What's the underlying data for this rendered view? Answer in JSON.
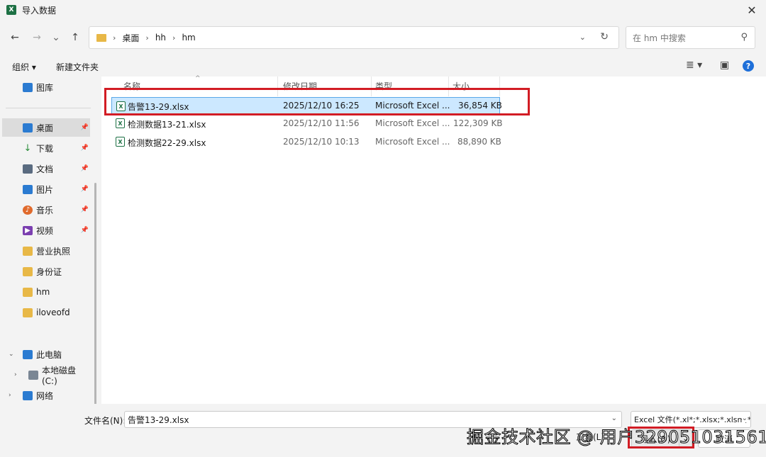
{
  "window": {
    "title": "导入数据",
    "app_icon": "X"
  },
  "nav": {
    "back": "←",
    "forward": "→",
    "recent": "⌄",
    "up": "↑",
    "breadcrumb": [
      "桌面",
      "hh",
      "hm"
    ],
    "separator": "›",
    "search_placeholder": "在 hm 中搜索"
  },
  "toolbar": {
    "organize": "组织 ▾",
    "new_folder": "新建文件夹"
  },
  "sidebar": {
    "top": {
      "label": "图库"
    },
    "quick": [
      {
        "label": "桌面",
        "color": "#2b7bd1"
      },
      {
        "label": "下载",
        "color": "#2a8d3a"
      },
      {
        "label": "文档",
        "color": "#5a6b80"
      },
      {
        "label": "图片",
        "color": "#2b7bd1"
      },
      {
        "label": "音乐",
        "color": "#e06a2c"
      },
      {
        "label": "视频",
        "color": "#7b3fb0"
      }
    ],
    "folders": [
      "营业执照",
      "身份证",
      "hm",
      "iloveofd"
    ],
    "this_pc": "此电脑",
    "local_disk": "本地磁盘 (C:)",
    "network": "网络"
  },
  "table": {
    "headers": {
      "name": "名称",
      "modified": "修改日期",
      "type": "类型",
      "size": "大小"
    },
    "rows": [
      {
        "name": "告警13-29.xlsx",
        "modified": "2025/12/10 16:25",
        "type": "Microsoft Excel ...",
        "size": "36,854 KB"
      },
      {
        "name": "检测数据13-21.xlsx",
        "modified": "2025/12/10 11:56",
        "type": "Microsoft Excel ...",
        "size": "122,309 KB"
      },
      {
        "name": "检测数据22-29.xlsx",
        "modified": "2025/12/10 10:13",
        "type": "Microsoft Excel ...",
        "size": "88,890 KB"
      }
    ]
  },
  "bottom": {
    "filename_label": "文件名(N):",
    "filename_value": "告警13-29.xlsx",
    "filetype": "Excel 文件(*.xl*;*.xlsx;*.xlsm;*.",
    "tools": "工具(L)",
    "open": "导入(O)",
    "cancel": "取消"
  },
  "watermark": "掘金技术社区 @ 用户329051031561",
  "colors": {
    "highlight": "#d21c24",
    "selection": "#cce8ff",
    "excel": "#1d7044"
  }
}
